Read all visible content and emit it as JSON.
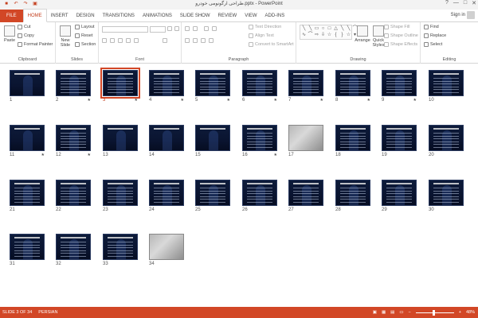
{
  "window": {
    "title": "طراحی ارگونومی خودرو.pptx - PowerPoint",
    "minimize": "—",
    "maximize": "□",
    "close": "✕",
    "help": "?"
  },
  "qat": {
    "save": "■",
    "undo": "↶",
    "redo": "↷",
    "start": "▣"
  },
  "tabs": [
    "FILE",
    "HOME",
    "INSERT",
    "DESIGN",
    "TRANSITIONS",
    "ANIMATIONS",
    "SLIDE SHOW",
    "REVIEW",
    "VIEW",
    "ADD-INS"
  ],
  "active_tab": "HOME",
  "account": {
    "label": "Sign in"
  },
  "ribbon": {
    "clipboard": {
      "label": "Clipboard",
      "paste": "Paste",
      "cut": "Cut",
      "copy": "Copy",
      "format_painter": "Format Painter"
    },
    "slides": {
      "label": "Slides",
      "new_slide": "New Slide",
      "layout": "Layout",
      "reset": "Reset",
      "section": "Section"
    },
    "font": {
      "label": "Font"
    },
    "paragraph": {
      "label": "Paragraph",
      "text_direction": "Text Direction",
      "align_text": "Align Text",
      "convert_smartart": "Convert to SmartArt"
    },
    "drawing": {
      "label": "Drawing",
      "arrange": "Arrange",
      "quick_styles": "Quick Styles",
      "shape_fill": "Shape Fill",
      "shape_outline": "Shape Outline",
      "shape_effects": "Shape Effects"
    },
    "editing": {
      "label": "Editing",
      "find": "Find",
      "replace": "Replace",
      "select": "Select"
    }
  },
  "slides": [
    {
      "num": "1",
      "star": "",
      "kind": "title"
    },
    {
      "num": "2",
      "star": "★",
      "kind": "text"
    },
    {
      "num": "3",
      "star": "★",
      "kind": "text",
      "selected": true
    },
    {
      "num": "4",
      "star": "★",
      "kind": "text"
    },
    {
      "num": "5",
      "star": "★",
      "kind": "text"
    },
    {
      "num": "6",
      "star": "★",
      "kind": "text"
    },
    {
      "num": "7",
      "star": "★",
      "kind": "text"
    },
    {
      "num": "8",
      "star": "★",
      "kind": "text"
    },
    {
      "num": "9",
      "star": "★",
      "kind": "text"
    },
    {
      "num": "10",
      "star": "",
      "kind": "text"
    },
    {
      "num": "11",
      "star": "★",
      "kind": "figure"
    },
    {
      "num": "12",
      "star": "★",
      "kind": "text"
    },
    {
      "num": "13",
      "star": "",
      "kind": "figure"
    },
    {
      "num": "14",
      "star": "",
      "kind": "figure"
    },
    {
      "num": "15",
      "star": "",
      "kind": "figure"
    },
    {
      "num": "16",
      "star": "★",
      "kind": "text"
    },
    {
      "num": "17",
      "star": "",
      "kind": "light"
    },
    {
      "num": "18",
      "star": "",
      "kind": "text"
    },
    {
      "num": "19",
      "star": "",
      "kind": "text"
    },
    {
      "num": "20",
      "star": "",
      "kind": "text"
    },
    {
      "num": "21",
      "star": "",
      "kind": "text"
    },
    {
      "num": "22",
      "star": "",
      "kind": "text"
    },
    {
      "num": "23",
      "star": "",
      "kind": "text"
    },
    {
      "num": "24",
      "star": "",
      "kind": "text"
    },
    {
      "num": "25",
      "star": "",
      "kind": "text"
    },
    {
      "num": "26",
      "star": "",
      "kind": "text"
    },
    {
      "num": "27",
      "star": "",
      "kind": "text"
    },
    {
      "num": "28",
      "star": "",
      "kind": "text"
    },
    {
      "num": "29",
      "star": "",
      "kind": "text"
    },
    {
      "num": "30",
      "star": "",
      "kind": "text"
    },
    {
      "num": "31",
      "star": "",
      "kind": "text"
    },
    {
      "num": "32",
      "star": "",
      "kind": "text"
    },
    {
      "num": "33",
      "star": "",
      "kind": "text"
    },
    {
      "num": "34",
      "star": "",
      "kind": "light"
    }
  ],
  "status": {
    "slide_info": "SLIDE 3 OF 34",
    "language": "PERSIAN",
    "zoom": "48%",
    "zoom_level": 0.48,
    "minus": "−",
    "plus": "+"
  }
}
